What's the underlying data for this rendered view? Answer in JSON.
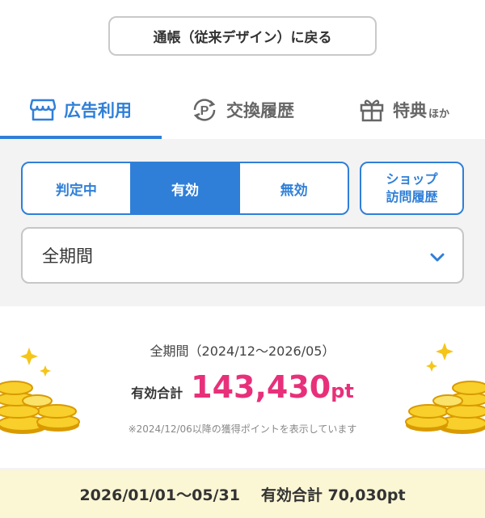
{
  "header": {
    "back_button_label": "通帳（従来デザイン）に戻る"
  },
  "tabs": [
    {
      "label": "広告利用",
      "icon": "store-icon",
      "active": true
    },
    {
      "label": "交換履歴",
      "icon": "point-exchange-icon",
      "active": false
    },
    {
      "label": "特典",
      "suffix": "ほか",
      "icon": "gift-icon",
      "active": false
    }
  ],
  "filters": {
    "segments": [
      {
        "label": "判定中",
        "active": false
      },
      {
        "label": "有効",
        "active": true
      },
      {
        "label": "無効",
        "active": false
      }
    ],
    "shop_history_button": {
      "line1": "ショップ",
      "line2": "訪問履歴"
    },
    "period_select": {
      "value": "全期間",
      "icon": "chevron-down-icon"
    }
  },
  "summary": {
    "period_text": "全期間（2024/12〜2026/05）",
    "total_label": "有効合計",
    "total_value": "143,430",
    "total_unit": "pt",
    "note": "※2024/12/06以降の獲得ポイントを表示しています"
  },
  "footer": {
    "range": "2026/01/01〜05/31",
    "total_text": "有効合計 70,030pt"
  },
  "colors": {
    "accent": "#2f7fd8",
    "highlight": "#e8307a",
    "footer_bg": "#fbf6d4"
  }
}
